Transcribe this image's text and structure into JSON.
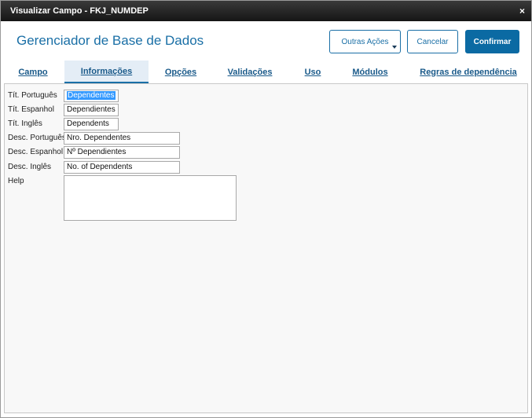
{
  "window": {
    "title": "Visualizar Campo - FKJ_NUMDEP",
    "close_glyph": "×"
  },
  "header": {
    "title": "Gerenciador de Base de Dados",
    "outras_acoes_label": "Outras Ações",
    "cancelar_label": "Cancelar",
    "confirmar_label": "Confirmar"
  },
  "tabs": [
    {
      "label": "Campo"
    },
    {
      "label": "Informações",
      "active": true
    },
    {
      "label": "Opções"
    },
    {
      "label": "Validações"
    },
    {
      "label": "Uso"
    },
    {
      "label": "Módulos"
    },
    {
      "label": "Regras de dependência"
    }
  ],
  "form": {
    "tit_portugues": {
      "label": "Tít. Português",
      "value": "Dependentes"
    },
    "tit_espanhol": {
      "label": "Tít. Espanhol",
      "value": "Dependientes"
    },
    "tit_ingles": {
      "label": "Tít. Inglês",
      "value": "Dependents"
    },
    "desc_portugues": {
      "label": "Desc. Português",
      "value": "Nro. Dependentes"
    },
    "desc_espanhol": {
      "label": "Desc. Espanhol",
      "value": "Nº Dependientes"
    },
    "desc_ingles": {
      "label": "Desc. Inglês",
      "value": "No. of Dependents"
    },
    "help": {
      "label": "Help",
      "value": ""
    }
  },
  "colors": {
    "accent": "#1a6fa6",
    "primary_button": "#0b6aa3",
    "titlebar": "#1e1e1e"
  }
}
